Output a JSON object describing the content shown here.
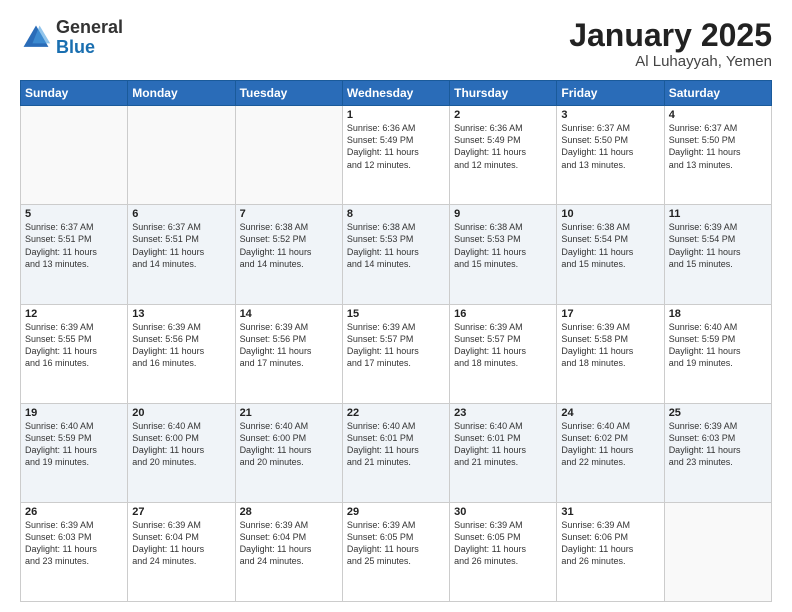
{
  "header": {
    "logo": {
      "general": "General",
      "blue": "Blue"
    },
    "title": "January 2025",
    "location": "Al Luhayyah, Yemen"
  },
  "weekdays": [
    "Sunday",
    "Monday",
    "Tuesday",
    "Wednesday",
    "Thursday",
    "Friday",
    "Saturday"
  ],
  "weeks": [
    [
      {
        "day": "",
        "info": ""
      },
      {
        "day": "",
        "info": ""
      },
      {
        "day": "",
        "info": ""
      },
      {
        "day": "1",
        "info": "Sunrise: 6:36 AM\nSunset: 5:49 PM\nDaylight: 11 hours\nand 12 minutes."
      },
      {
        "day": "2",
        "info": "Sunrise: 6:36 AM\nSunset: 5:49 PM\nDaylight: 11 hours\nand 12 minutes."
      },
      {
        "day": "3",
        "info": "Sunrise: 6:37 AM\nSunset: 5:50 PM\nDaylight: 11 hours\nand 13 minutes."
      },
      {
        "day": "4",
        "info": "Sunrise: 6:37 AM\nSunset: 5:50 PM\nDaylight: 11 hours\nand 13 minutes."
      }
    ],
    [
      {
        "day": "5",
        "info": "Sunrise: 6:37 AM\nSunset: 5:51 PM\nDaylight: 11 hours\nand 13 minutes."
      },
      {
        "day": "6",
        "info": "Sunrise: 6:37 AM\nSunset: 5:51 PM\nDaylight: 11 hours\nand 14 minutes."
      },
      {
        "day": "7",
        "info": "Sunrise: 6:38 AM\nSunset: 5:52 PM\nDaylight: 11 hours\nand 14 minutes."
      },
      {
        "day": "8",
        "info": "Sunrise: 6:38 AM\nSunset: 5:53 PM\nDaylight: 11 hours\nand 14 minutes."
      },
      {
        "day": "9",
        "info": "Sunrise: 6:38 AM\nSunset: 5:53 PM\nDaylight: 11 hours\nand 15 minutes."
      },
      {
        "day": "10",
        "info": "Sunrise: 6:38 AM\nSunset: 5:54 PM\nDaylight: 11 hours\nand 15 minutes."
      },
      {
        "day": "11",
        "info": "Sunrise: 6:39 AM\nSunset: 5:54 PM\nDaylight: 11 hours\nand 15 minutes."
      }
    ],
    [
      {
        "day": "12",
        "info": "Sunrise: 6:39 AM\nSunset: 5:55 PM\nDaylight: 11 hours\nand 16 minutes."
      },
      {
        "day": "13",
        "info": "Sunrise: 6:39 AM\nSunset: 5:56 PM\nDaylight: 11 hours\nand 16 minutes."
      },
      {
        "day": "14",
        "info": "Sunrise: 6:39 AM\nSunset: 5:56 PM\nDaylight: 11 hours\nand 17 minutes."
      },
      {
        "day": "15",
        "info": "Sunrise: 6:39 AM\nSunset: 5:57 PM\nDaylight: 11 hours\nand 17 minutes."
      },
      {
        "day": "16",
        "info": "Sunrise: 6:39 AM\nSunset: 5:57 PM\nDaylight: 11 hours\nand 18 minutes."
      },
      {
        "day": "17",
        "info": "Sunrise: 6:39 AM\nSunset: 5:58 PM\nDaylight: 11 hours\nand 18 minutes."
      },
      {
        "day": "18",
        "info": "Sunrise: 6:40 AM\nSunset: 5:59 PM\nDaylight: 11 hours\nand 19 minutes."
      }
    ],
    [
      {
        "day": "19",
        "info": "Sunrise: 6:40 AM\nSunset: 5:59 PM\nDaylight: 11 hours\nand 19 minutes."
      },
      {
        "day": "20",
        "info": "Sunrise: 6:40 AM\nSunset: 6:00 PM\nDaylight: 11 hours\nand 20 minutes."
      },
      {
        "day": "21",
        "info": "Sunrise: 6:40 AM\nSunset: 6:00 PM\nDaylight: 11 hours\nand 20 minutes."
      },
      {
        "day": "22",
        "info": "Sunrise: 6:40 AM\nSunset: 6:01 PM\nDaylight: 11 hours\nand 21 minutes."
      },
      {
        "day": "23",
        "info": "Sunrise: 6:40 AM\nSunset: 6:01 PM\nDaylight: 11 hours\nand 21 minutes."
      },
      {
        "day": "24",
        "info": "Sunrise: 6:40 AM\nSunset: 6:02 PM\nDaylight: 11 hours\nand 22 minutes."
      },
      {
        "day": "25",
        "info": "Sunrise: 6:39 AM\nSunset: 6:03 PM\nDaylight: 11 hours\nand 23 minutes."
      }
    ],
    [
      {
        "day": "26",
        "info": "Sunrise: 6:39 AM\nSunset: 6:03 PM\nDaylight: 11 hours\nand 23 minutes."
      },
      {
        "day": "27",
        "info": "Sunrise: 6:39 AM\nSunset: 6:04 PM\nDaylight: 11 hours\nand 24 minutes."
      },
      {
        "day": "28",
        "info": "Sunrise: 6:39 AM\nSunset: 6:04 PM\nDaylight: 11 hours\nand 24 minutes."
      },
      {
        "day": "29",
        "info": "Sunrise: 6:39 AM\nSunset: 6:05 PM\nDaylight: 11 hours\nand 25 minutes."
      },
      {
        "day": "30",
        "info": "Sunrise: 6:39 AM\nSunset: 6:05 PM\nDaylight: 11 hours\nand 26 minutes."
      },
      {
        "day": "31",
        "info": "Sunrise: 6:39 AM\nSunset: 6:06 PM\nDaylight: 11 hours\nand 26 minutes."
      },
      {
        "day": "",
        "info": ""
      }
    ]
  ]
}
